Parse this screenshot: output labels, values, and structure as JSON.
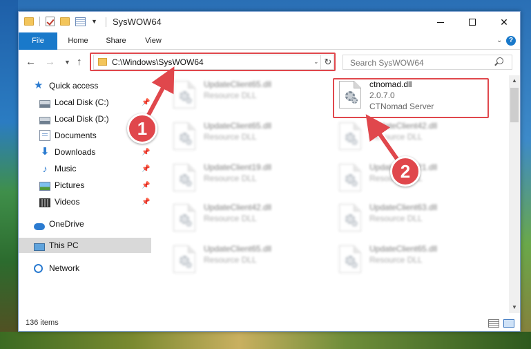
{
  "window": {
    "title": "SysWOW64"
  },
  "ribbon": {
    "tabs": [
      {
        "label": "File"
      },
      {
        "label": "Home"
      },
      {
        "label": "Share"
      },
      {
        "label": "View"
      }
    ],
    "help": "?"
  },
  "nav": {
    "address": "C:\\Windows\\SysWOW64",
    "search_placeholder": "Search SysWOW64"
  },
  "sidebar": {
    "items": [
      {
        "label": "Quick access",
        "icon": "star-icon",
        "pinned": false
      },
      {
        "label": "Local Disk (C:)",
        "icon": "drive-icon",
        "pinned": true
      },
      {
        "label": "Local Disk (D:)",
        "icon": "drive-icon",
        "pinned": false
      },
      {
        "label": "Documents",
        "icon": "documents-icon",
        "pinned": false
      },
      {
        "label": "Downloads",
        "icon": "download-icon",
        "pinned": true
      },
      {
        "label": "Music",
        "icon": "music-icon",
        "pinned": true
      },
      {
        "label": "Pictures",
        "icon": "pictures-icon",
        "pinned": true
      },
      {
        "label": "Videos",
        "icon": "videos-icon",
        "pinned": true
      },
      {
        "label": "OneDrive",
        "icon": "cloud-icon",
        "pinned": false
      },
      {
        "label": "This PC",
        "icon": "computer-icon",
        "pinned": false,
        "selected": true
      },
      {
        "label": "Network",
        "icon": "network-icon",
        "pinned": false
      }
    ]
  },
  "files": {
    "highlighted": {
      "name": "ctnomad.dll",
      "version": "2.0.7.0",
      "description": "CTNomad Server"
    },
    "blurred": [
      {
        "name": "UpdateClient65.dll",
        "type": "Resource DLL"
      },
      {
        "name": "UpdateClient65.dll",
        "type": "Resource DLL"
      },
      {
        "name": "UpdateClient42.dll",
        "type": "Resource DLL"
      },
      {
        "name": "UpdateClient19.dll",
        "type": "Resource DLL"
      },
      {
        "name": "UpdateClient21.dll",
        "type": "Resource DLL"
      },
      {
        "name": "UpdateClient42.dll",
        "type": "Resource DLL"
      },
      {
        "name": "UpdateClient63.dll",
        "type": "Resource DLL"
      },
      {
        "name": "UpdateClient65.dll",
        "type": "Resource DLL"
      },
      {
        "name": "UpdateClient65.dll",
        "type": "Resource DLL"
      }
    ]
  },
  "status": {
    "item_count": "136 items"
  },
  "annotations": {
    "marker1": "1",
    "marker2": "2",
    "color": "#e0474c"
  }
}
